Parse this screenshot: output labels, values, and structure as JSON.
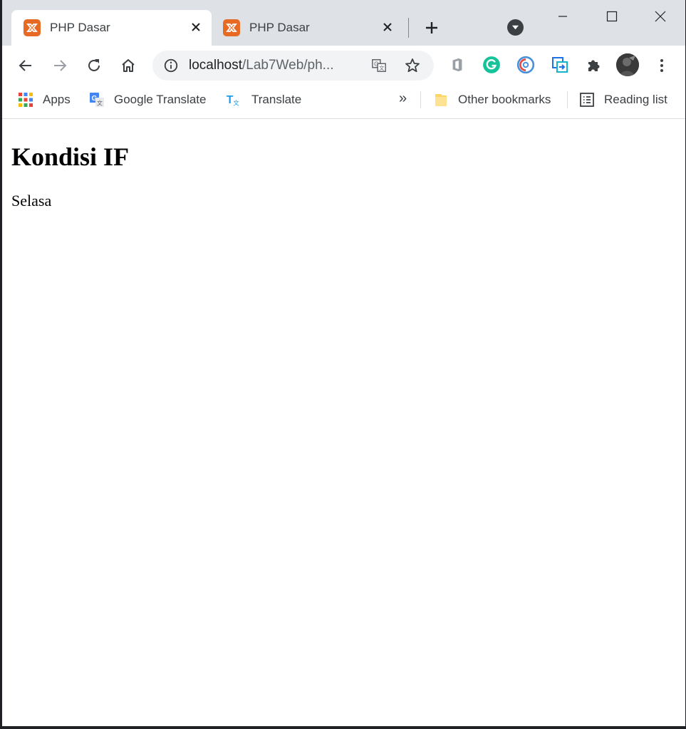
{
  "tabs": [
    {
      "title": "PHP Dasar",
      "active": true
    },
    {
      "title": "PHP Dasar",
      "active": false
    }
  ],
  "toolbar": {
    "url_host": "localhost",
    "url_path": "/Lab7Web/ph..."
  },
  "bookmarks": {
    "items": [
      {
        "label": "Apps",
        "icon": "apps-grid-icon"
      },
      {
        "label": "Google Translate",
        "icon": "google-translate-icon"
      },
      {
        "label": "Translate",
        "icon": "translate-icon"
      }
    ],
    "more": "»",
    "other": "Other bookmarks",
    "reading_list": "Reading list"
  },
  "page": {
    "heading": "Kondisi IF",
    "text": "Selasa"
  },
  "colors": {
    "tabstrip_bg": "#dee1e6",
    "favicon": "#e66a24",
    "omnibox_bg": "#f1f3f4",
    "grammarly": "#15c39a"
  }
}
